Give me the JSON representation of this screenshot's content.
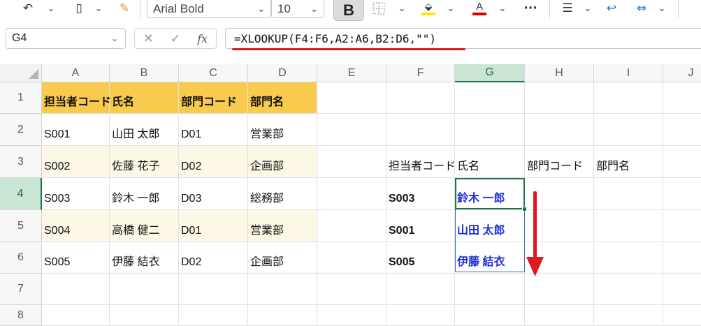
{
  "toolbar": {
    "font_name": "Arial Bold",
    "font_size": "10",
    "bold_label": "B",
    "font_color": "#e00000",
    "fill_color": "#ffe600",
    "more": "···"
  },
  "formula_bar": {
    "cell_ref": "G4",
    "formula": "=XLOOKUP(F4:F6,A2:A6,B2:D6,\"\")",
    "fx": "fx"
  },
  "columns": [
    "A",
    "B",
    "C",
    "D",
    "E",
    "F",
    "G",
    "H",
    "I",
    "J"
  ],
  "rows": [
    "1",
    "2",
    "3",
    "4",
    "5",
    "6",
    "7",
    "8"
  ],
  "cells": {
    "A1": "担当者コード",
    "B1": "氏名",
    "C1": "部門コード",
    "D1": "部門名",
    "A2": "S001",
    "B2": "山田 太郎",
    "C2": "D01",
    "D2": "営業部",
    "A3": "S002",
    "B3": "佐藤 花子",
    "C3": "D02",
    "D3": "企画部",
    "A4": "S003",
    "B4": "鈴木 一郎",
    "C4": "D03",
    "D4": "総務部",
    "A5": "S004",
    "B5": "高橋 健二",
    "C5": "D01",
    "D5": "営業部",
    "A6": "S005",
    "B6": "伊藤 結衣",
    "C6": "D02",
    "D6": "企画部",
    "F3": "担当者コード",
    "G3": "氏名",
    "H3": "部門コード",
    "I3": "部門名",
    "F4": "S003",
    "G4": "鈴木 一郎",
    "F5": "S001",
    "G5": "山田 太郎",
    "F6": "S005",
    "G6": "伊藤 結衣"
  },
  "colors": {
    "header_fill": "#f8ca4d",
    "band_fill": "#fdf7e6",
    "selection": "#217346",
    "result_text": "#1f2fd6",
    "annotation": "#e0191f"
  }
}
